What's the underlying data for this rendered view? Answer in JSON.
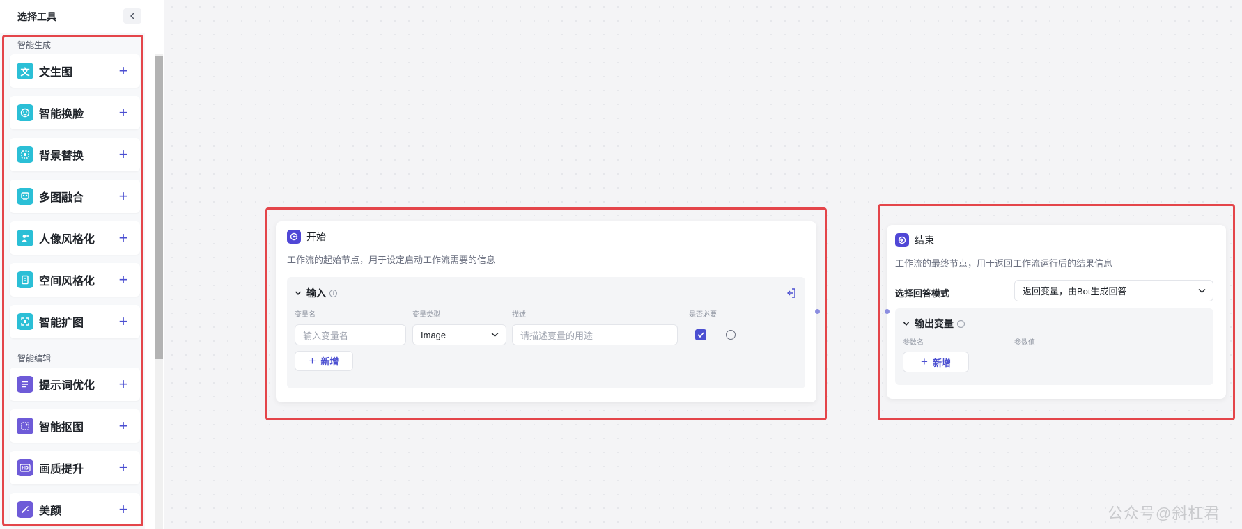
{
  "sidebar": {
    "title": "选择工具",
    "collapse_icon": "chevron-left-icon",
    "sections": [
      {
        "title": "智能生成",
        "items": [
          {
            "label": "文生图",
            "icon": "text-to-image-icon",
            "color": "#2bbfd6"
          },
          {
            "label": "智能换脸",
            "icon": "face-swap-icon",
            "color": "#2bbfd6"
          },
          {
            "label": "背景替换",
            "icon": "background-replace-icon",
            "color": "#2bbfd6"
          },
          {
            "label": "多图融合",
            "icon": "multi-image-fusion-icon",
            "color": "#2bbfd6"
          },
          {
            "label": "人像风格化",
            "icon": "portrait-style-icon",
            "color": "#2bbfd6"
          },
          {
            "label": "空间风格化",
            "icon": "space-style-icon",
            "color": "#2bbfd6"
          },
          {
            "label": "智能扩图",
            "icon": "image-expand-icon",
            "color": "#2bbfd6"
          }
        ]
      },
      {
        "title": "智能编辑",
        "items": [
          {
            "label": "提示词优化",
            "icon": "prompt-optimize-icon",
            "color": "#6e5bd8"
          },
          {
            "label": "智能抠图",
            "icon": "cutout-icon",
            "color": "#6e5bd8"
          },
          {
            "label": "画质提升",
            "icon": "hd-icon",
            "color": "#6e5bd8"
          },
          {
            "label": "美颜",
            "icon": "beauty-brush-icon",
            "color": "#6e5bd8"
          }
        ]
      }
    ]
  },
  "start_node": {
    "title": "开始",
    "description": "工作流的起始节点，用于设定启动工作流需要的信息",
    "input_section": {
      "title": "输入",
      "columns": [
        "变量名",
        "变量类型",
        "描述",
        "是否必要"
      ],
      "row": {
        "name_placeholder": "输入变量名",
        "type_value": "Image",
        "desc_placeholder": "请描述变量的用途",
        "required": true
      },
      "add_label": "新增"
    }
  },
  "end_node": {
    "title": "结束",
    "description": "工作流的最终节点，用于返回工作流运行后的结果信息",
    "mode_label": "选择回答模式",
    "mode_value": "返回变量，由Bot生成回答",
    "output_section": {
      "title": "输出变量",
      "columns": [
        "参数名",
        "参数值"
      ],
      "add_label": "新增"
    }
  },
  "watermark": "公众号@斜杠君",
  "colors": {
    "accent": "#4b4fd1",
    "highlight": "#e4454a",
    "teal": "#2bbfd6",
    "violet": "#6e5bd8"
  }
}
